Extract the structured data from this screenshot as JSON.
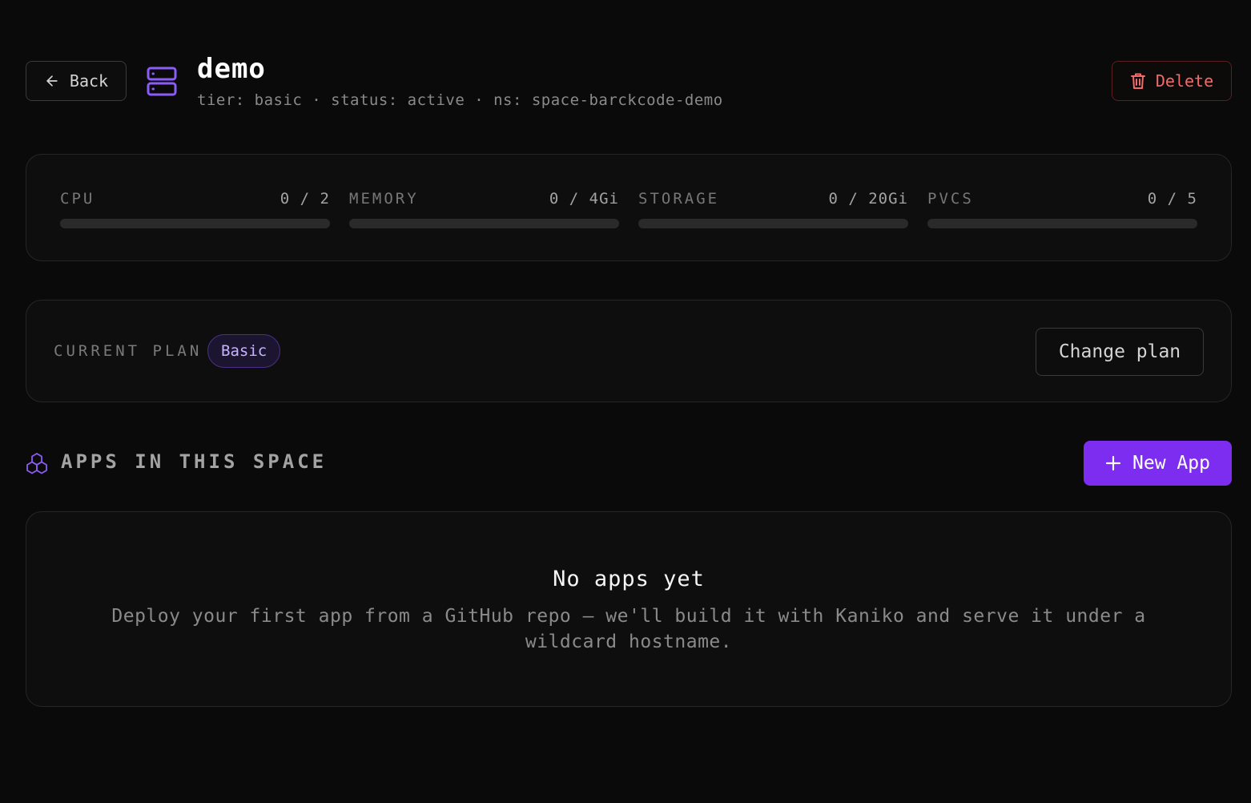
{
  "header": {
    "back_label": "Back",
    "title": "demo",
    "subtitle": "tier: basic · status: active · ns: space-barckcode-demo",
    "delete_label": "Delete"
  },
  "usage": [
    {
      "label": "CPU",
      "value": "0 / 2",
      "fraction": 0
    },
    {
      "label": "MEMORY",
      "value": "0 / 4Gi",
      "fraction": 0
    },
    {
      "label": "STORAGE",
      "value": "0 / 20Gi",
      "fraction": 0
    },
    {
      "label": "PVCS",
      "value": "0 / 5",
      "fraction": 0
    }
  ],
  "plan": {
    "label": "CURRENT PLAN",
    "badge": "Basic",
    "change_label": "Change plan"
  },
  "apps": {
    "title": "APPS IN THIS SPACE",
    "new_app_label": "New App",
    "empty_title": "No apps yet",
    "empty_desc": "Deploy your first app from a GitHub repo — we'll build it with Kaniko and serve it under a wildcard hostname."
  },
  "colors": {
    "accent": "#7c2df0",
    "accent_light": "#8b5cf6",
    "danger": "#f16b6b",
    "background": "#0a0a0a"
  },
  "icons": {
    "back": "arrow-left-icon",
    "space": "server-icon",
    "delete": "trash-icon",
    "apps": "boxes-icon",
    "new_app": "plus-icon"
  }
}
